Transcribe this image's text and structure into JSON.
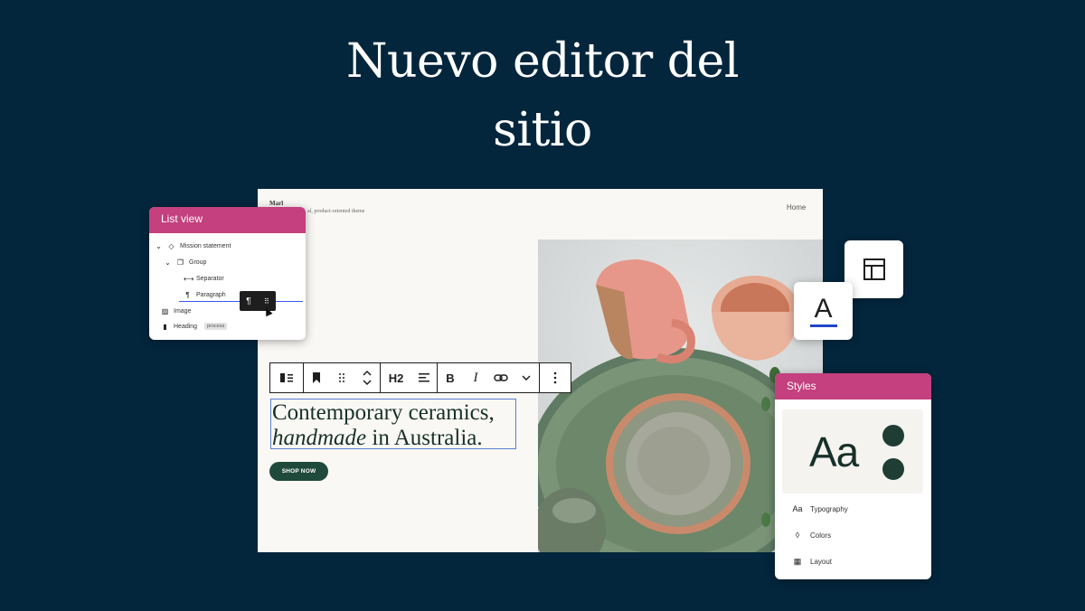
{
  "headline": {
    "line1": "Nuevo editor del",
    "line2": "sitio"
  },
  "site": {
    "title": "Marl",
    "tagline": "al, product-oriented theme",
    "nav_home": "Home",
    "hero_line1": "Contemporary ceramics,",
    "hero_line2_italic": "handmade",
    "hero_line2_rest": " in Australia.",
    "shop_button": "SHOP NOW"
  },
  "list_view": {
    "title": "List view",
    "items": [
      {
        "label": "Mission statement",
        "icon": "chevron-down-icon"
      },
      {
        "label": "Group",
        "icon": "group-icon"
      },
      {
        "label": "Separator",
        "icon": "separator-icon"
      },
      {
        "label": "Paragraph",
        "icon": "paragraph-icon"
      },
      {
        "label": "Image",
        "icon": "image-icon"
      },
      {
        "label": "Heading",
        "icon": "bookmark-icon",
        "badge": "process"
      }
    ]
  },
  "toolbar": {
    "heading_level": "H2",
    "bold": "B",
    "italic": "I"
  },
  "styles_panel": {
    "title": "Styles",
    "preview_text": "Aa",
    "items": [
      {
        "icon_text": "Aa",
        "label": "Typography"
      },
      {
        "icon_text": "◊",
        "label": "Colors"
      },
      {
        "icon_text": "▦",
        "label": "Layout"
      }
    ]
  },
  "type_tile": {
    "letter": "A"
  },
  "colors": {
    "background": "#03263d",
    "accent_pink": "#c4407e",
    "dark_green": "#1f4a3b",
    "selection_blue": "#3858e9"
  }
}
